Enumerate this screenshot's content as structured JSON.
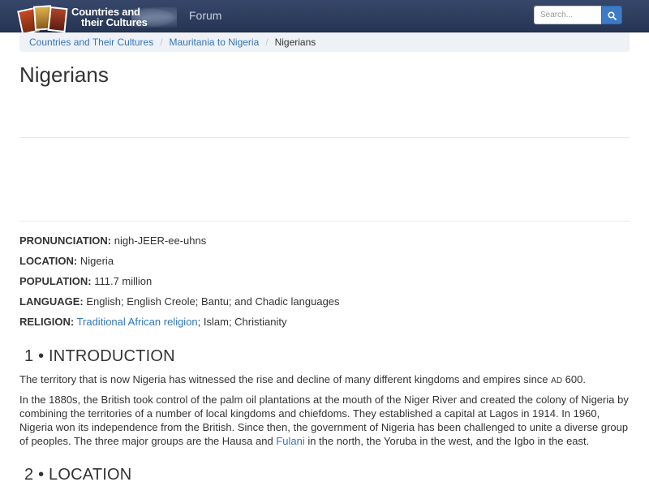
{
  "header": {
    "logo_line1": "Countries and",
    "logo_line2": "their Cultures",
    "nav_forum": "Forum",
    "search_placeholder": "Search...",
    "bar_color": "#2d3c5e",
    "accent": "#3d7cc4"
  },
  "breadcrumb": [
    {
      "label": "Countries and Their Cultures"
    },
    {
      "label": "Mauritania to Nigeria"
    },
    {
      "label": "Nigerians"
    }
  ],
  "page_title": "Nigerians",
  "facts": {
    "pronunciation_label": "PRONUNCIATION:",
    "pronunciation_value": " nigh-JEER-ee-uhns",
    "location_label": "LOCATION:",
    "location_value": " Nigeria",
    "population_label": "POPULATION:",
    "population_value": " 111.7 million",
    "language_label": "LANGUAGE:",
    "language_value": " English; English Creole; Bantu; and Chadic languages",
    "religion_label": "RELIGION:",
    "religion_link": "Traditional African religion",
    "religion_rest": "; Islam; Christianity"
  },
  "sections": [
    {
      "heading": "1 • INTRODUCTION"
    },
    {
      "heading": "2 • LOCATION"
    }
  ],
  "intro": {
    "p1_a": "The territory that is now Nigeria has witnessed the rise and decline of many different kingdoms and empires since ",
    "p1_ad": "AD",
    "p1_b": " 600.",
    "p2_a": "In the 1880s, the British took control of the palm oil plantations at the mouth of the Niger River and created the colony of Nigeria by combining the territories of a number of local kingdoms and chiefdoms. They established a capital at Lagos in 1914. In 1960, Nigeria won its independence from the British. Since then, the government of Nigeria has been challenged to unite a diverse group of peoples. The three major groups are the Hausa and ",
    "p2_link": "Fulani",
    "p2_b": " in the north, the Yoruba in the west, and the Igbo in the east."
  }
}
